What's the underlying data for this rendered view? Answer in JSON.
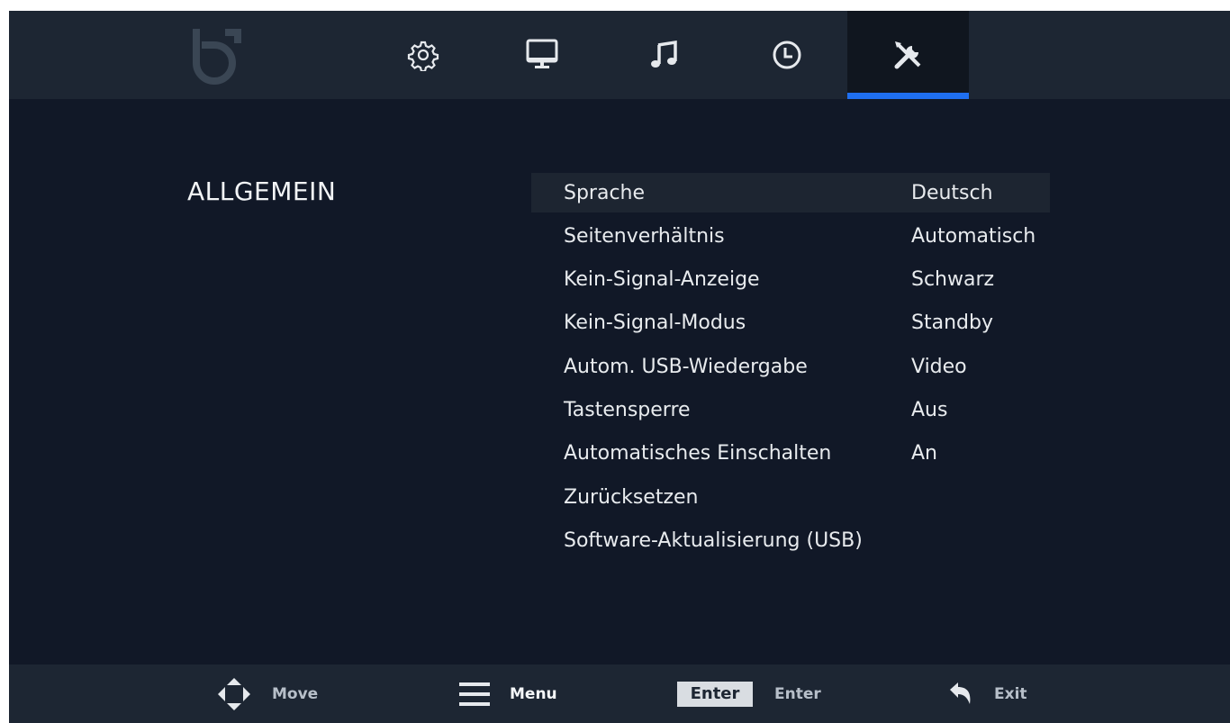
{
  "colors": {
    "background": "#111827",
    "topbar": "#1d2633",
    "accent": "#1f6ff0",
    "text": "#e8ebee",
    "selected_row": "#1d2531"
  },
  "top_nav": {
    "logo": "brand-logo",
    "tabs": [
      {
        "icon": "gear-icon",
        "active": false
      },
      {
        "icon": "monitor-icon",
        "active": false
      },
      {
        "icon": "music-note-icon",
        "active": false
      },
      {
        "icon": "clock-icon",
        "active": false
      },
      {
        "icon": "tools-icon",
        "active": true
      }
    ]
  },
  "section": {
    "title": "ALLGEMEIN"
  },
  "settings": [
    {
      "label": "Sprache",
      "value": "Deutsch",
      "selected": true
    },
    {
      "label": "Seitenverhältnis",
      "value": "Automatisch"
    },
    {
      "label": "Kein-Signal-Anzeige",
      "value": "Schwarz"
    },
    {
      "label": "Kein-Signal-Modus",
      "value": "Standby"
    },
    {
      "label": "Autom. USB-Wiedergabe",
      "value": "Video"
    },
    {
      "label": "Tastensperre",
      "value": "Aus"
    },
    {
      "label": "Automatisches Einschalten",
      "value": "An"
    },
    {
      "label": "Zurücksetzen",
      "value": ""
    },
    {
      "label": "Software-Aktualisierung (USB)",
      "value": ""
    }
  ],
  "footer": {
    "move": {
      "icon": "dpad-icon",
      "label": "Move"
    },
    "menu": {
      "icon": "hamburger-menu-icon",
      "label": "Menu"
    },
    "enter": {
      "key": "Enter",
      "label": "Enter"
    },
    "exit": {
      "icon": "return-arrow-icon",
      "label": "Exit"
    }
  }
}
